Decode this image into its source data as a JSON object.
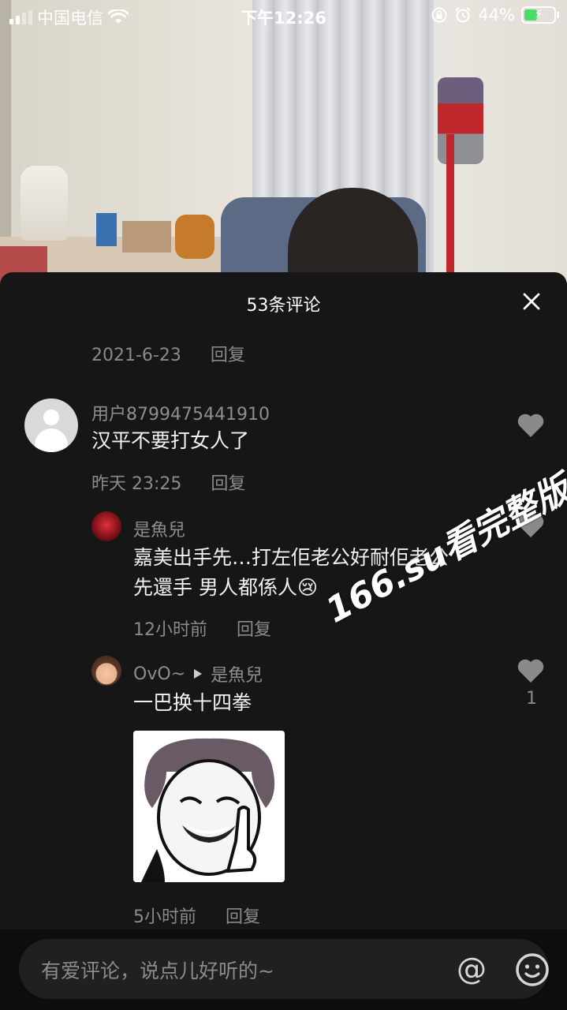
{
  "status_bar": {
    "carrier": "中国电信",
    "time": "下午12:26",
    "battery": "44%",
    "battery_level": 0.44,
    "icons": [
      "signal-icon",
      "wifi-icon",
      "orientation-lock-icon",
      "alarm-icon",
      "battery-charging-icon"
    ]
  },
  "panel": {
    "title": "53条评论"
  },
  "comments": {
    "top_meta": {
      "date": "2021-6-23",
      "reply": "回复"
    },
    "c1": {
      "user": "用户8799475441910",
      "text": "汉平不要打女人了",
      "date": "昨天 23:25",
      "reply": "回复"
    },
    "c2": {
      "user": "是魚兒",
      "text_line1": "嘉美出手先…打左佢老公好耐佢老公",
      "text_line2": "先還手 男人都係人😢",
      "date": "12小时前",
      "reply": "回复"
    },
    "c3": {
      "user": "OvO~",
      "reply_to": "是魚兒",
      "text": "一巴换十四拳",
      "date": "5小时前",
      "reply": "回复",
      "likes": "1"
    }
  },
  "watermark": "166.su看完整版",
  "input": {
    "placeholder": "有爱评论，说点儿好听的~",
    "at_symbol": "@"
  }
}
